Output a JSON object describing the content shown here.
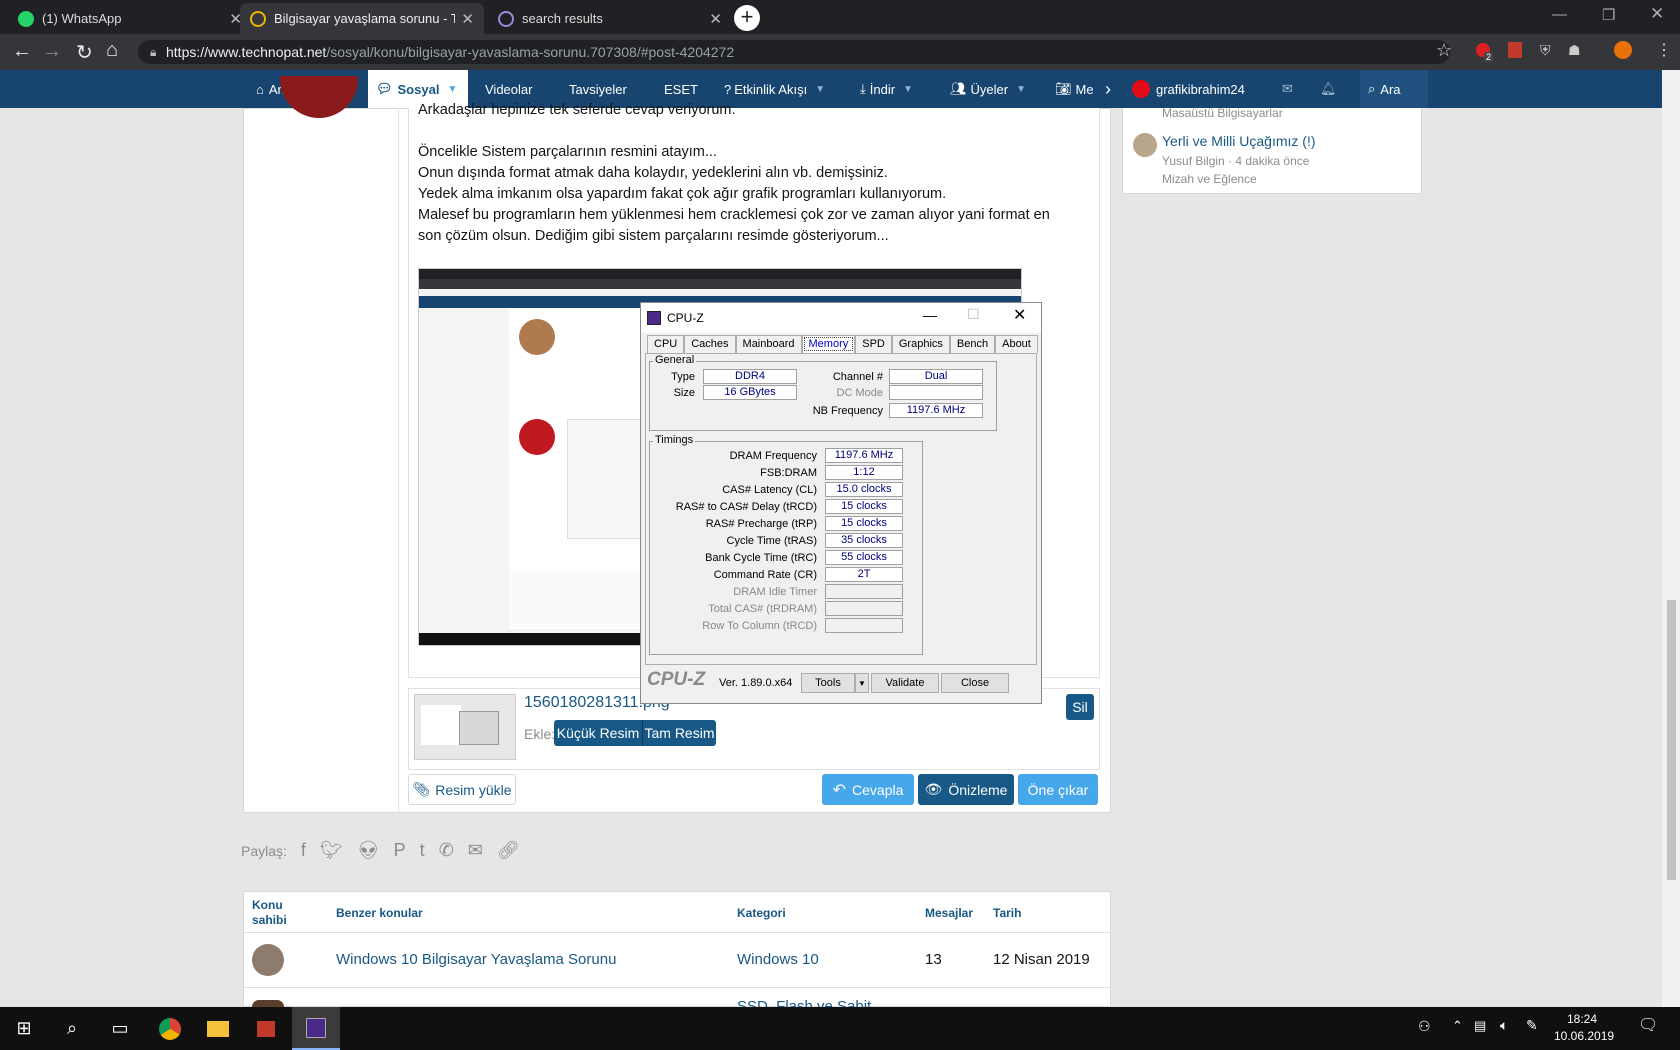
{
  "browser": {
    "tabs": [
      {
        "title": "(1) WhatsApp",
        "icon": "whatsapp-icon",
        "color": "#25d366"
      },
      {
        "title": "Bilgisayar yavaşlama sorunu - Te",
        "icon": "power-icon",
        "color": "#f0b400"
      },
      {
        "title": "search results",
        "icon": "at-icon",
        "color": "#9c88d8"
      }
    ],
    "url_prefix": "https://www.technopat.net",
    "url_rest": "/sosyal/konu/bilgisayar-yavaslama-sorunu.707308/#post-4204272",
    "ext_badge": "2"
  },
  "nav": {
    "items": [
      "Ana Sayfa",
      "Sosyal",
      "Videolar",
      "Tavsiyeler",
      "ESET",
      "Etkinlik Akışı",
      "İndir",
      "Üyeler",
      "Me"
    ],
    "user": "grafikibrahim24",
    "search": "Ara"
  },
  "post": {
    "lines": [
      "Arkadaşlar hepinize tek seferde cevap veriyorum.",
      "Öncelikle Sistem parçalarının resmini atayım...",
      "Onun dışında format atmak daha kolaydır, yedeklerini alın vb. demişsiniz.",
      "Yedek alma imkanım olsa yapardım fakat çok ağır grafik programları kullanıyorum.",
      "Malesef bu programların hem yüklenmesi hem cracklemesi çok zor ve zaman alıyor yani format en",
      "son çözüm olsun. Dediğim gibi sistem parçalarını resimde gösteriyorum..."
    ],
    "attachment_name": "1560180281311.png",
    "attach_label": "Ekle:",
    "small_image": "Küçük Resim",
    "full_image": "Tam Resim",
    "delete": "Sil",
    "upload": "Resim yükle",
    "reply": "Cevapla",
    "preview": "Önizleme",
    "feature": "Öne çıkar"
  },
  "sidebar": {
    "top_category": "Masaüstü Bilgisayarlar",
    "item_title": "Yerli ve Milli Uçağımız (!)",
    "item_meta": "Yusuf Bilgin · 4 dakika önce",
    "item_category": "Mizah ve Eğlence"
  },
  "share": {
    "label": "Paylaş:"
  },
  "table": {
    "headers": {
      "author": "Konu sahibi",
      "topic": "Benzer konular",
      "category": "Kategori",
      "messages": "Mesajlar",
      "date": "Tarih"
    },
    "rows": [
      {
        "topic": "Windows 10 Bilgisayar Yavaşlama Sorunu",
        "category": "Windows 10",
        "messages": "13",
        "date": "12 Nisan 2019"
      },
      {
        "topic": "",
        "category": "SSD, Flash ve Sabit",
        "messages": "",
        "date": ""
      }
    ]
  },
  "cpuz": {
    "title": "CPU-Z",
    "tabs": [
      "CPU",
      "Caches",
      "Mainboard",
      "Memory",
      "SPD",
      "Graphics",
      "Bench",
      "About"
    ],
    "general_label": "General",
    "type_label": "Type",
    "type": "DDR4",
    "size_label": "Size",
    "size": "16 GBytes",
    "channel_label": "Channel #",
    "channel": "Dual",
    "dcmode_label": "DC Mode",
    "dcmode": "",
    "nbfreq_label": "NB Frequency",
    "nbfreq": "1197.6 MHz",
    "timings_label": "Timings",
    "timings": [
      {
        "label": "DRAM Frequency",
        "value": "1197.6 MHz",
        "disabled": false
      },
      {
        "label": "FSB:DRAM",
        "value": "1:12",
        "disabled": false
      },
      {
        "label": "CAS# Latency (CL)",
        "value": "15.0 clocks",
        "disabled": false
      },
      {
        "label": "RAS# to CAS# Delay (tRCD)",
        "value": "15 clocks",
        "disabled": false
      },
      {
        "label": "RAS# Precharge (tRP)",
        "value": "15 clocks",
        "disabled": false
      },
      {
        "label": "Cycle Time (tRAS)",
        "value": "35 clocks",
        "disabled": false
      },
      {
        "label": "Bank Cycle Time (tRC)",
        "value": "55 clocks",
        "disabled": false
      },
      {
        "label": "Command Rate (CR)",
        "value": "2T",
        "disabled": false
      },
      {
        "label": "DRAM Idle Timer",
        "value": "",
        "disabled": true
      },
      {
        "label": "Total CAS# (tRDRAM)",
        "value": "",
        "disabled": true
      },
      {
        "label": "Row To Column (tRCD)",
        "value": "",
        "disabled": true
      }
    ],
    "logo": "CPU-Z",
    "version": "Ver. 1.89.0.x64",
    "tools": "Tools",
    "validate": "Validate",
    "close": "Close"
  },
  "taskbar": {
    "time": "18:24",
    "date": "10.06.2019"
  }
}
